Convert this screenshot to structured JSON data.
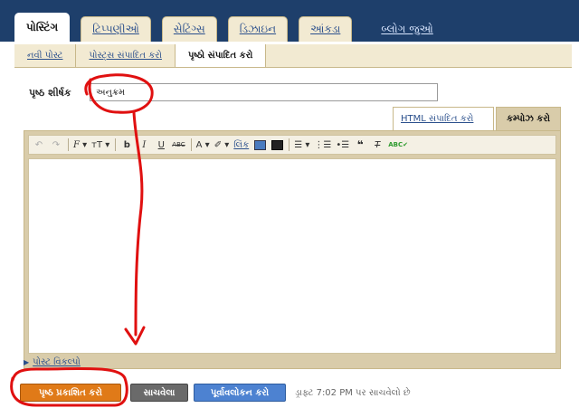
{
  "top_tabs": [
    {
      "label": "પોસ્ટિંગ",
      "active": true
    },
    {
      "label": "ટિપ્પણીઓ",
      "active": false
    },
    {
      "label": "સેટિંગ્સ",
      "active": false
    },
    {
      "label": "ડિઝાઇન",
      "active": false
    },
    {
      "label": "આંકડા",
      "active": false
    }
  ],
  "view_blog": "બ્લોગ જુઓ",
  "sub_nav": [
    {
      "label": "નવી પોસ્ટ",
      "active": false
    },
    {
      "label": "પોસ્ટ્સ સંપાદિત કરો",
      "active": false
    },
    {
      "label": "પૃષ્ઠો સંપાદિત કરો",
      "active": true
    }
  ],
  "page_title_label": "પૃષ્ઠ શીર્ષક",
  "page_title_value": "અનુક્રમ",
  "editor_modes": {
    "html": "HTML સંપાદિત કરો",
    "compose": "કમ્પોઝ કરો"
  },
  "toolbar": {
    "font_glyph": "F",
    "size_glyph": "тT",
    "bold": "b",
    "italic": "I",
    "underline": "U",
    "strike": "ABC",
    "text_color": "A",
    "highlight": "✐",
    "link": "લિંક",
    "quote": "❝",
    "spell": "ABC✔"
  },
  "post_options": "પોસ્ટ વિકલ્પો",
  "buttons": {
    "publish": "પૃષ્ઠ પ્રકાશિત કરો",
    "save": "સાચવેલા",
    "preview": "પૂર્વાવલોકન કરો"
  },
  "draft_status": "ડ્રાફ્ટ 7:02 PM પર સાચવેલો છે",
  "colors": {
    "header_bg": "#1e3f6b",
    "tab_bg": "#f2ead2",
    "editor_frame": "#d9ccaa",
    "publish_orange": "#e07a18",
    "preview_blue": "#4d82d1",
    "annotation_red": "#e01010"
  }
}
